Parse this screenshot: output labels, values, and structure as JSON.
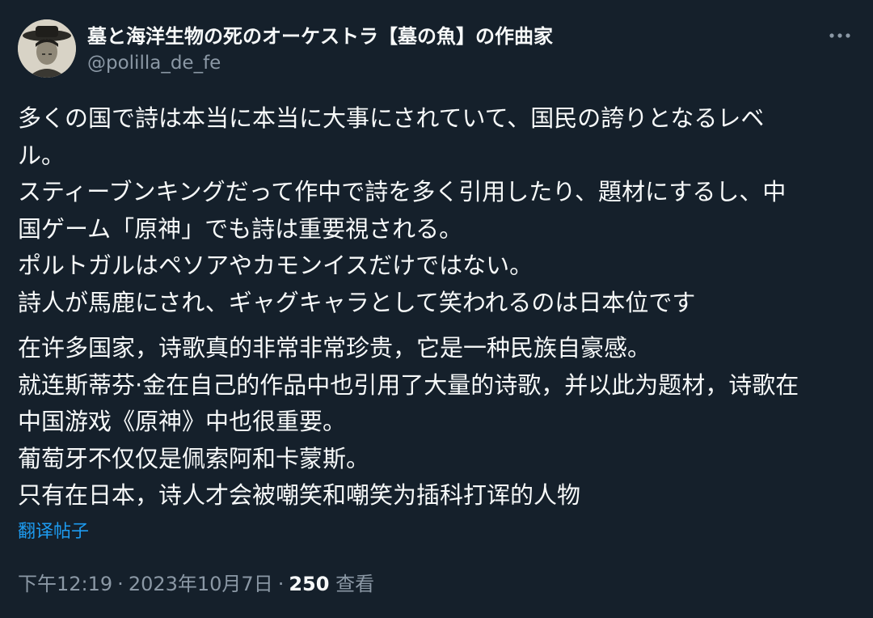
{
  "author": {
    "display_name": "墓と海洋生物の死のオーケストラ【墓の魚】の作曲家",
    "handle": "@polilla_de_fe"
  },
  "tweet": {
    "original_lines": [
      "多くの国で詩は本当に本当に大事にされていて、国民の誇りとなるレベ",
      "ル。",
      "スティーブンキングだって作中で詩を多く引用したり、題材にするし、中",
      "国ゲーム「原神」でも詩は重要視される。",
      "ポルトガルはペソアやカモンイスだけではない。",
      "詩人が馬鹿にされ、ギャグキャラとして笑われるのは日本位です"
    ],
    "translated_lines": [
      "在许多国家，诗歌真的非常非常珍贵，它是一种民族自豪感。",
      "就连斯蒂芬·金在自己的作品中也引用了大量的诗歌，并以此为题材，诗歌在",
      "中国游戏《原神》中也很重要。",
      "葡萄牙不仅仅是佩索阿和卡蒙斯。",
      "只有在日本，诗人才会被嘲笑和嘲笑为插科打诨的人物"
    ],
    "translate_label": "翻译帖子"
  },
  "meta": {
    "time": "下午12:19",
    "separator": "·",
    "date": "2023年10月7日",
    "views_count": "250",
    "views_label": "查看"
  },
  "colors": {
    "background": "#15202b",
    "text_primary": "#f7f9f9",
    "text_secondary": "#8b98a5",
    "link": "#1d9bf0"
  },
  "icons": {
    "more": "more-horizontal-icon"
  }
}
